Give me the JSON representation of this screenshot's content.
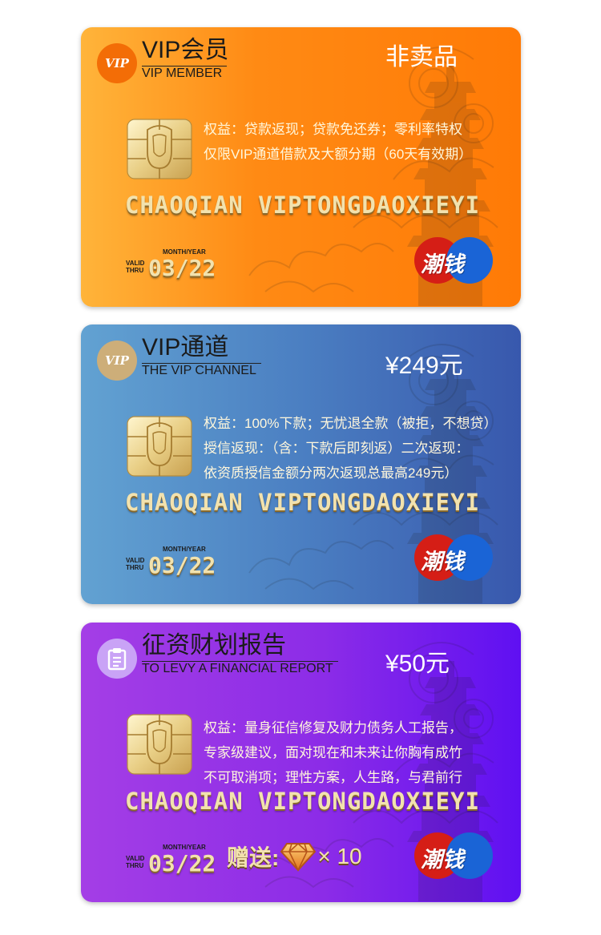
{
  "colors": {
    "card1_gradient": [
      "#ffb43a",
      "#ff7a06"
    ],
    "card2_gradient": [
      "#62a2d2",
      "#3858ad"
    ],
    "card3_gradient": [
      "#a43ee6",
      "#5f10f2"
    ],
    "brand_red": "#d51e16",
    "brand_blue": "#1a64d6",
    "gold_text": "#f2e2ae"
  },
  "cards": [
    {
      "badge_text": "VIP",
      "title": "VIP会员",
      "subtitle": "VIP MEMBER",
      "price": "非卖品",
      "benefits": [
        "权益：贷款返现；贷款免还券；零利率特权",
        "仅限VIP通道借款及大额分期（60天有效期）"
      ],
      "card_name": "CHAOQIAN VIPTONGDAOXIEYI",
      "month_year": "MONTH/YEAR",
      "valid_thru": [
        "VALID",
        "THRU"
      ],
      "expiry": "03/22",
      "brand": "潮钱"
    },
    {
      "badge_text": "VIP",
      "title": "VIP通道",
      "subtitle": "THE VIP CHANNEL",
      "price": "¥249元",
      "benefits": [
        "权益：100%下款；无忧退全款（被拒，不想贷）",
        "授信返现：（含：下款后即刻返）二次返现：",
        "依资质授信金额分两次返现总最高249元）"
      ],
      "card_name": "CHAOQIAN VIPTONGDAOXIEYI",
      "month_year": "MONTH/YEAR",
      "valid_thru": [
        "VALID",
        "THRU"
      ],
      "expiry": "03/22",
      "brand": "潮钱"
    },
    {
      "badge_icon": "clipboard-icon",
      "title": "征资财划报告",
      "subtitle": "TO LEVY A FINANCIAL REPORT",
      "price": "¥50元",
      "benefits": [
        "权益：量身征信修复及财力债务人工报告，",
        "专家级建议，面对现在和未来让你胸有成竹",
        "不可取消项；理性方案，人生路，与君前行"
      ],
      "card_name": "CHAOQIAN VIPTONGDAOXIEYI",
      "month_year": "MONTH/YEAR",
      "valid_thru": [
        "VALID",
        "THRU"
      ],
      "expiry": "03/22",
      "gift_label": "赠送:",
      "gift_icon": "diamond-icon",
      "gift_count": "× 10",
      "brand": "潮钱"
    }
  ]
}
